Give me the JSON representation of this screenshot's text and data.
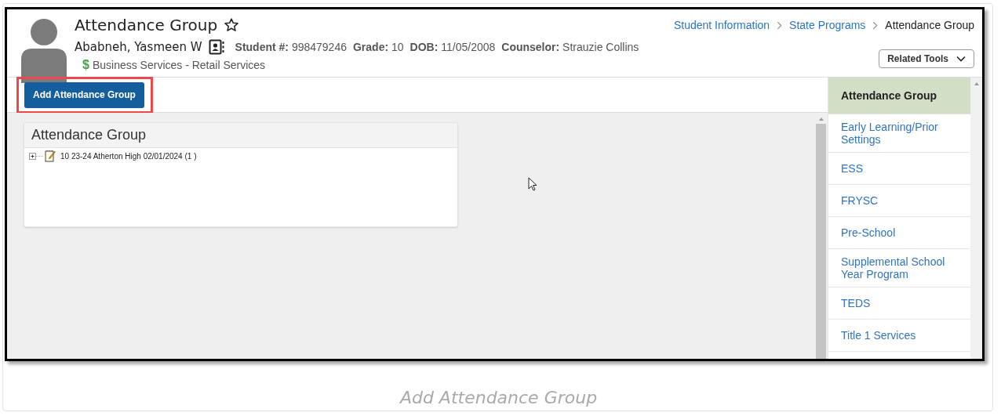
{
  "header": {
    "title": "Attendance Group",
    "student_name": "Ababneh, Yasmeen W",
    "fields": [
      {
        "label": "Student #:",
        "value": "998479246"
      },
      {
        "label": "Grade:",
        "value": "10"
      },
      {
        "label": "DOB:",
        "value": "11/05/2008"
      },
      {
        "label": "Counselor:",
        "value": "Strauzie Collins"
      }
    ],
    "program_symbol": "$",
    "program": "Business Services - Retail Services",
    "breadcrumb": [
      {
        "label": "Student Information",
        "link": true
      },
      {
        "label": "State Programs",
        "link": true
      },
      {
        "label": "Attendance Group",
        "link": false
      }
    ],
    "related_tools": "Related Tools"
  },
  "toolbar": {
    "button": "Add Attendance Group",
    "highlighted": true
  },
  "panel": {
    "title": "Attendance Group",
    "tree": [
      {
        "label": "10 23-24 Atherton High 02/01/2024 (1 )",
        "expanded": false
      }
    ]
  },
  "sidebar": {
    "items": [
      {
        "label": "Attendance Group",
        "selected": true
      },
      {
        "label": "Early Learning/Prior Settings",
        "selected": false
      },
      {
        "label": "ESS",
        "selected": false
      },
      {
        "label": "FRYSC",
        "selected": false
      },
      {
        "label": "Pre-School",
        "selected": false
      },
      {
        "label": "Supplemental School Year Program",
        "selected": false
      },
      {
        "label": "TEDS",
        "selected": false
      },
      {
        "label": "Title 1 Services",
        "selected": false
      }
    ]
  },
  "caption": "Add Attendance Group"
}
